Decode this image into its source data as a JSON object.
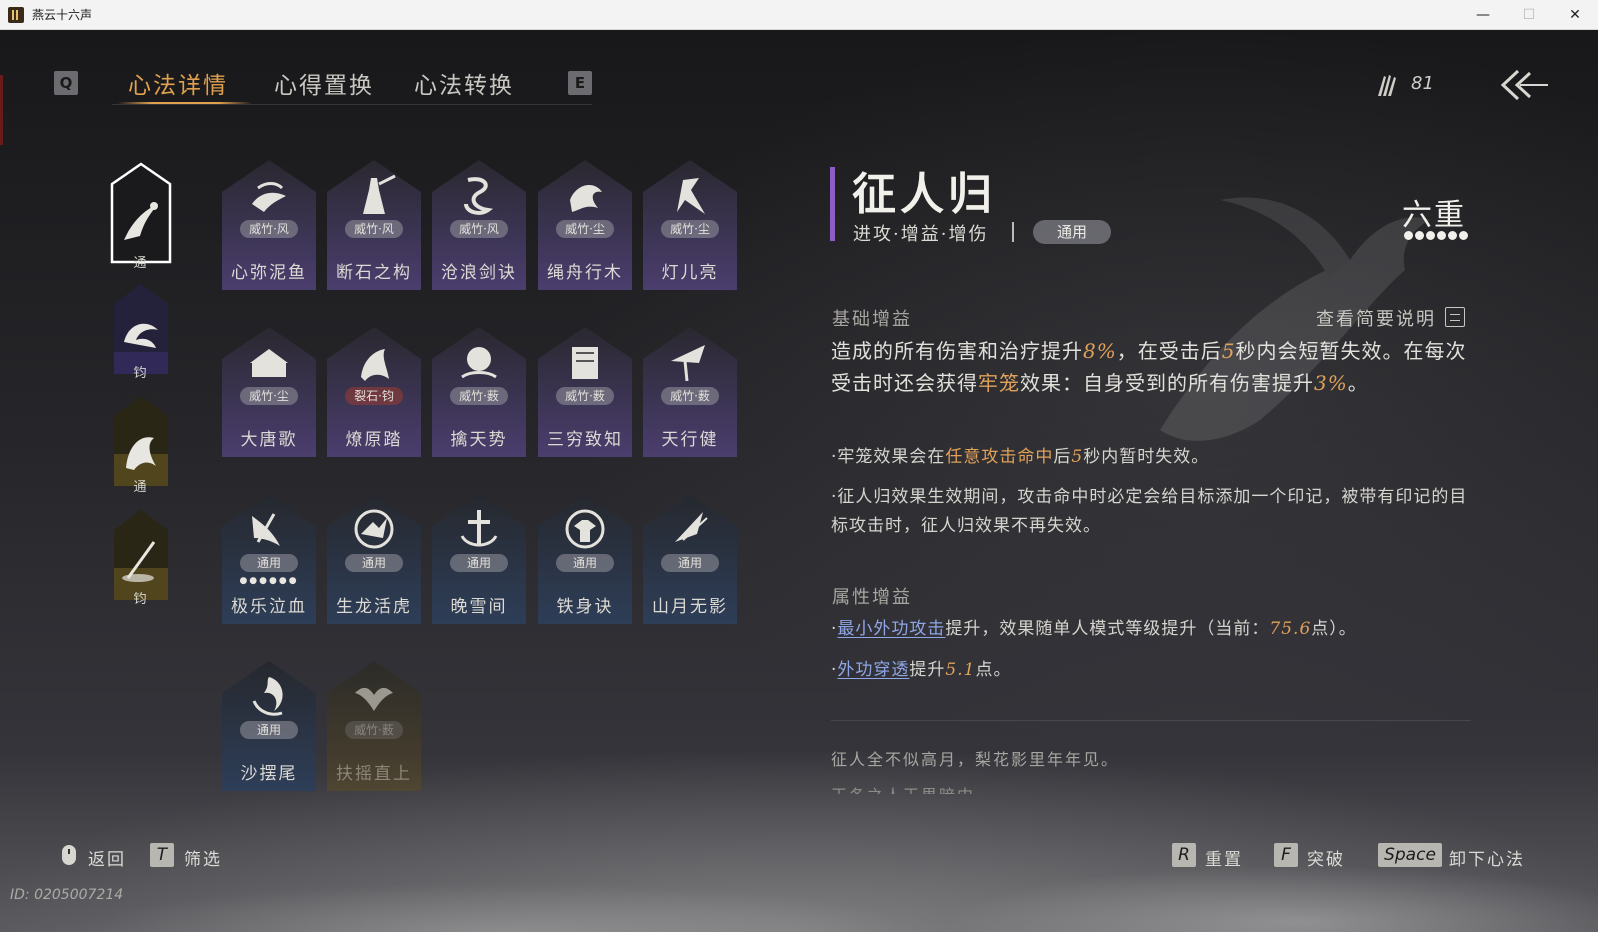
{
  "window": {
    "title": "燕云十六声",
    "minimize": "—",
    "maximize": "☐",
    "close": "✕"
  },
  "tabs": {
    "prev_key": "Q",
    "next_key": "E",
    "items": [
      {
        "label": "心法详情"
      },
      {
        "label": "心得置换"
      },
      {
        "label": "心法转换"
      }
    ]
  },
  "currency": {
    "value": "81",
    "icon": "feather-bundle-icon"
  },
  "slots": [
    {
      "tag": "通",
      "icon": "crow-icon",
      "color": "#8a8a92"
    },
    {
      "tag": "钧",
      "icon": "wave-icon",
      "color": "#6a5aa8"
    },
    {
      "tag": "通",
      "icon": "horse-icon",
      "color": "#9c8a4a"
    },
    {
      "tag": "钧",
      "icon": "sword-icon",
      "color": "#9c8a4a"
    }
  ],
  "cards": [
    {
      "name": "心弥泥鱼",
      "tag": "威竹·风",
      "icon": "fish-icon",
      "theme": "purple"
    },
    {
      "name": "断石之构",
      "tag": "威竹·风",
      "icon": "warrior-icon",
      "theme": "purple"
    },
    {
      "name": "沧浪剑诀",
      "tag": "威竹·风",
      "icon": "dragon-icon",
      "theme": "purple"
    },
    {
      "name": "绳舟行木",
      "tag": "威竹·尘",
      "icon": "octopus-icon",
      "theme": "purple"
    },
    {
      "name": "灯儿亮",
      "tag": "威竹·尘",
      "icon": "lantern-icon",
      "theme": "purple"
    },
    {
      "name": "大唐歌",
      "tag": "威竹·尘",
      "icon": "palace-icon",
      "theme": "purple"
    },
    {
      "name": "燎原踏",
      "tag": "裂石·钧",
      "icon": "horse-rider-icon",
      "theme": "purple",
      "red": true
    },
    {
      "name": "擒天势",
      "tag": "威竹·薮",
      "icon": "chain-fist-icon",
      "theme": "purple"
    },
    {
      "name": "三穷致知",
      "tag": "威竹·薮",
      "icon": "scroll-icon",
      "theme": "purple"
    },
    {
      "name": "天行健",
      "tag": "威竹·薮",
      "icon": "umbrella-icon",
      "theme": "purple"
    },
    {
      "name": "极乐泣血",
      "tag": "通用",
      "icon": "blade-icon",
      "theme": "blue",
      "dots": "●●●●●●"
    },
    {
      "name": "生龙活虎",
      "tag": "通用",
      "icon": "tiger-icon",
      "theme": "blue"
    },
    {
      "name": "晚雪间",
      "tag": "通用",
      "icon": "anchor-icon",
      "theme": "blue"
    },
    {
      "name": "铁身诀",
      "tag": "通用",
      "icon": "strongman-icon",
      "theme": "blue"
    },
    {
      "name": "山月无影",
      "tag": "通用",
      "icon": "slash-icon",
      "theme": "blue"
    },
    {
      "name": "沙摆尾",
      "tag": "通用",
      "icon": "swirl-icon",
      "theme": "blue"
    },
    {
      "name": "扶摇直上",
      "tag": "威竹·薮",
      "icon": "eagle-icon",
      "theme": "gold",
      "locked": true
    }
  ],
  "detail": {
    "title": "征人归",
    "subtitle": "进攻·增益·增伤",
    "pill": "通用",
    "level": "六重",
    "level_dots": 6,
    "accent_color": "#8d5cc4",
    "base_header": "基础增益",
    "brief_link": "查看简要说明",
    "base": {
      "p1_a": "造成的所有伤害和治疗提升",
      "p1_b": "8%",
      "p1_c": "，在受击后",
      "p1_d": "5",
      "p1_e": "秒内会短暂失效。在每次受击时还会获得",
      "p1_f": "牢笼",
      "p1_g": "效果：自身受到的所有伤害提升",
      "p1_h": "3%",
      "p1_i": "。",
      "b1_a": "·牢笼效果会在",
      "b1_b": "任意攻击命中",
      "b1_c": "后",
      "b1_d": "5",
      "b1_e": "秒内暂时失效。",
      "b2": "·征人归效果生效期间，攻击命中时必定会给目标添加一个印记，被带有印记的目标攻击时，征人归效果不再失效。"
    },
    "attr_header": "属性增益",
    "attr": {
      "a1_dot": "·",
      "a1_link": "最小外功攻击",
      "a1_text": "提升，效果随单人模式等级提升（当前：",
      "a1_num": "75.6",
      "a1_end": "点）。",
      "a2_dot": "·",
      "a2_link": "外功穿透",
      "a2_text": "提升",
      "a2_num": "5.1",
      "a2_end": "点。"
    },
    "flavor": "征人全不似高月，梨花影里年年见。",
    "flavor2": "王冬之人王果暗中"
  },
  "hints": {
    "back_label": "返回",
    "filter_key": "T",
    "filter_label": "筛选",
    "reset_key": "R",
    "reset_label": "重置",
    "break_key": "F",
    "break_label": "突破",
    "unequip_key": "Space",
    "unequip_label": "卸下心法"
  },
  "id_text": "ID: 0205007214"
}
